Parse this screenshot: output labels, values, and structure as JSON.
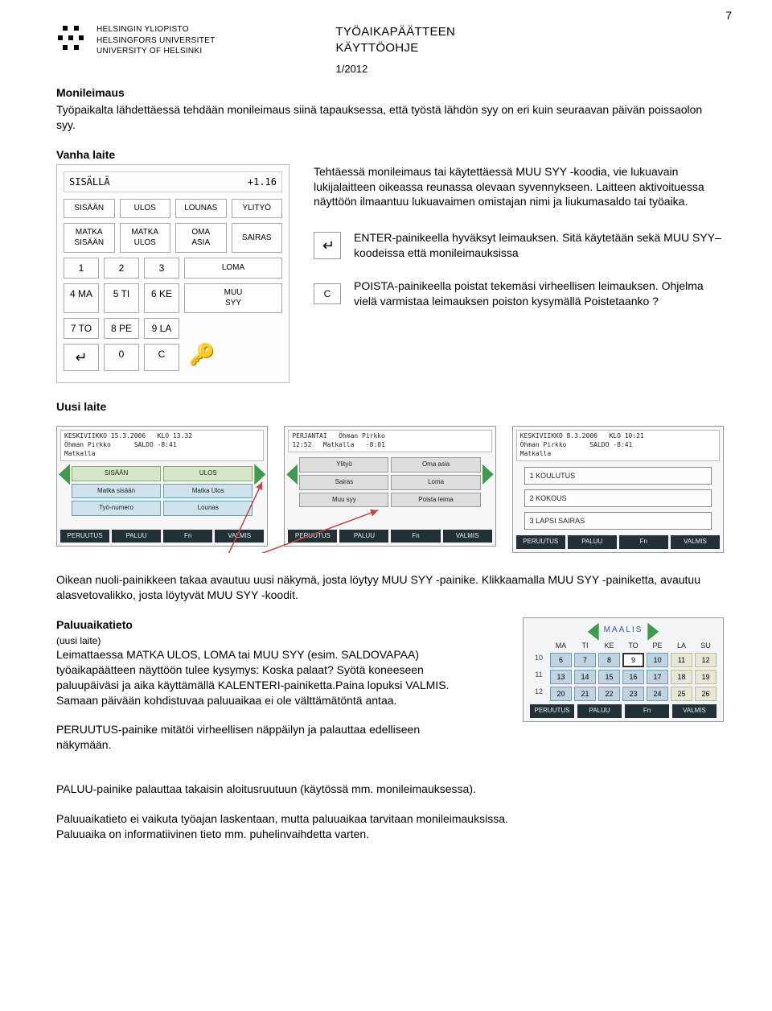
{
  "page_number": "7",
  "header": {
    "uni": [
      "HELSINGIN YLIOPISTO",
      "HELSINGFORS UNIVERSITET",
      "UNIVERSITY OF HELSINKI"
    ],
    "title_line1": "TYÖAIKAPÄÄTTEEN",
    "title_line2": "KÄYTTÖOHJE",
    "date": "1/2012"
  },
  "section1": {
    "heading": "Monileimaus",
    "body": "Työpaikalta lähdettäessä tehdään monileimaus siinä tapauksessa, että työstä lähdön syy on eri kuin seuraavan päivän poissaolon syy."
  },
  "vanha_label": "Vanha laite",
  "uusi_label": "Uusi laite",
  "right_para": "Tehtäessä monileimaus tai käytettäessä MUU SYY -koodia, vie lukuavain lukijalaitteen oikeassa reunassa olevaan syvennykseen. Laitteen aktivoituessa näyttöön ilmaantuu lukuavaimen omistajan nimi ja liukumasaldo tai työaika.",
  "enter_text": "ENTER-painikeella hyväksyt leimauksen. Sitä käytetään sekä MUU SYY–koodeissa että monileimauksissa",
  "c_label": "C",
  "c_text": "POISTA-painikeella poistat tekemäsi virheellisen leimauksen. Ohjelma vielä varmistaa leimauksen poiston kysymällä Poistetaanko ?",
  "keypad": {
    "status": "SISÄLLÄ",
    "balance": "+1.16",
    "row1": [
      "SISÄÄN",
      "ULOS",
      "LOUNAS",
      "YLITYÖ"
    ],
    "row2a": [
      "MATKA",
      "MATKA",
      "OMA",
      ""
    ],
    "row2b": [
      "SISÄÄN",
      "ULOS",
      "ASIA",
      "SAIRAS"
    ],
    "numrow1": [
      "1",
      "2",
      "3",
      "LOMA"
    ],
    "numrow2": [
      "4 MA",
      "5 TI",
      "6 KE",
      "MUU"
    ],
    "numrow2b": "SYY",
    "numrow3": [
      "7 TO",
      "8 PE",
      "9 LA",
      ""
    ],
    "numrow4_enter": "↵",
    "numrow4": [
      "0",
      "C"
    ],
    "key_icon": "🔑"
  },
  "screen1": {
    "head_l": "KESKIVIIKKO  15.3.2006",
    "head_r": "KLO 13.32",
    "head_b": "Öhman Pirkko",
    "head_c": "Matkalla",
    "head_d": "SALDO -8:41",
    "btns": [
      "SISÄÄN",
      "ULOS",
      "Matka sisään",
      "Matka Ulos",
      "Työ-numero",
      "Lounas"
    ],
    "footer": [
      "PERUUTUS",
      "PALUU",
      "Fn",
      "VALMIS"
    ]
  },
  "screen2": {
    "head_l": "PERJANTAI",
    "head_m": "Öhman Pirkko",
    "head_r": "",
    "head_b": "12:52",
    "head_c": "Matkalla",
    "head_d": "-8:01",
    "btns": [
      "Ylityö",
      "Oma asia",
      "Sairas",
      "Loma",
      "Muu syy",
      "Poista leima"
    ],
    "footer": [
      "PERUUTUS",
      "PALUU",
      "Fn",
      "VALMIS"
    ]
  },
  "screen3": {
    "head_l": "KESKIVIIKKO  8.3.2006",
    "head_r": "KLO 10:21",
    "head_b": "Öhman Pirkko",
    "head_c": "Matkalla",
    "head_d": "SALDO -8:41",
    "items": [
      "1 KOULUTUS",
      "2 KOKOUS",
      "3 LAPSI SAIRAS"
    ],
    "footer": [
      "PERUUTUS",
      "PALUU",
      "Fn",
      "VALMIS"
    ]
  },
  "after_screens": "Oikean nuoli-painikkeen takaa avautuu uusi näkymä, josta löytyy MUU SYY -painike. Klikkaamalla MUU SYY -painiketta, avautuu alasvetovalikko, josta löytyvät MUU SYY -koodit.",
  "paluuaika": {
    "heading": "Paluuaikatieto",
    "note": "(uusi laite)",
    "body": "Leimattaessa MATKA ULOS, LOMA tai MUU SYY (esim. SALDOVAPAA) työaikapäätteen näyttöön tulee kysymys: Koska palaat? Syötä koneeseen paluupäiväsi ja aika käyttämällä KALENTERI-painiketta.Paina lopuksi VALMIS. Samaan päivään kohdistuvaa paluuaikaa ei ole välttämätöntä antaa."
  },
  "calendar": {
    "title": "MAALIS",
    "days": [
      "MA",
      "TI",
      "KE",
      "TO",
      "PE",
      "LA",
      "SU"
    ],
    "rows": [
      {
        "wk": "10",
        "cells": [
          "6",
          "7",
          "8",
          "9",
          "10",
          "11",
          "12"
        ],
        "sel": 3
      },
      {
        "wk": "11",
        "cells": [
          "13",
          "14",
          "15",
          "16",
          "17",
          "18",
          "19"
        ]
      },
      {
        "wk": "12",
        "cells": [
          "20",
          "21",
          "22",
          "23",
          "24",
          "25",
          "26"
        ]
      }
    ],
    "footer": [
      "PERUUTUS",
      "PALUU",
      "Fn",
      "VALMIS"
    ]
  },
  "peruutus_text": "PERUUTUS-painike mitätöi virheellisen näppäilyn ja palauttaa edelliseen näkymään.",
  "paluu_text1": "PALUU-painike palauttaa takaisin aloitusruutuun (käytössä mm. monileimauksessa).",
  "paluu_text2": "Paluuaikatieto ei vaikuta työajan laskentaan, mutta paluuaikaa tarvitaan monileimauksissa.",
  "paluu_text3": "Paluuaika on informatiivinen tieto mm. puhelinvaihdetta varten."
}
